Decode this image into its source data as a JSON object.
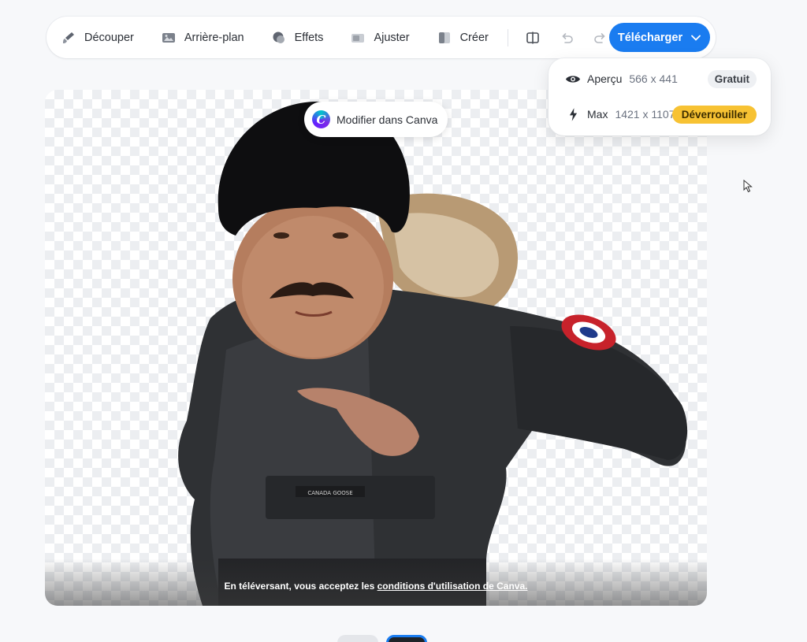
{
  "toolbar": {
    "tools": [
      {
        "label": "Découper",
        "icon": "brush-icon"
      },
      {
        "label": "Arrière-plan",
        "icon": "image-background-icon"
      },
      {
        "label": "Effets",
        "icon": "effects-icon"
      },
      {
        "label": "Ajuster",
        "icon": "adjust-icon"
      },
      {
        "label": "Créer",
        "icon": "create-icon"
      }
    ],
    "compare_icon": "compare-icon",
    "undo_icon": "undo-icon",
    "redo_icon": "redo-icon",
    "download_label": "Télécharger",
    "download_icon": "chevron-down-icon",
    "accent_color": "#1a7cf0"
  },
  "download_menu": {
    "preview": {
      "label": "Aperçu",
      "dimensions": "566 x 441",
      "badge": "Gratuit",
      "icon": "eye-icon"
    },
    "max": {
      "label": "Max",
      "dimensions": "1421 x 1107",
      "badge": "Déverrouiller",
      "icon": "bolt-icon",
      "badge_color": "#f7c233"
    }
  },
  "canvas": {
    "edit_in_canva_label": "Modifier dans Canva",
    "terms_prefix": "En téléversant, vous acceptez les ",
    "terms_link": "conditions d'utilisation de Canva."
  }
}
